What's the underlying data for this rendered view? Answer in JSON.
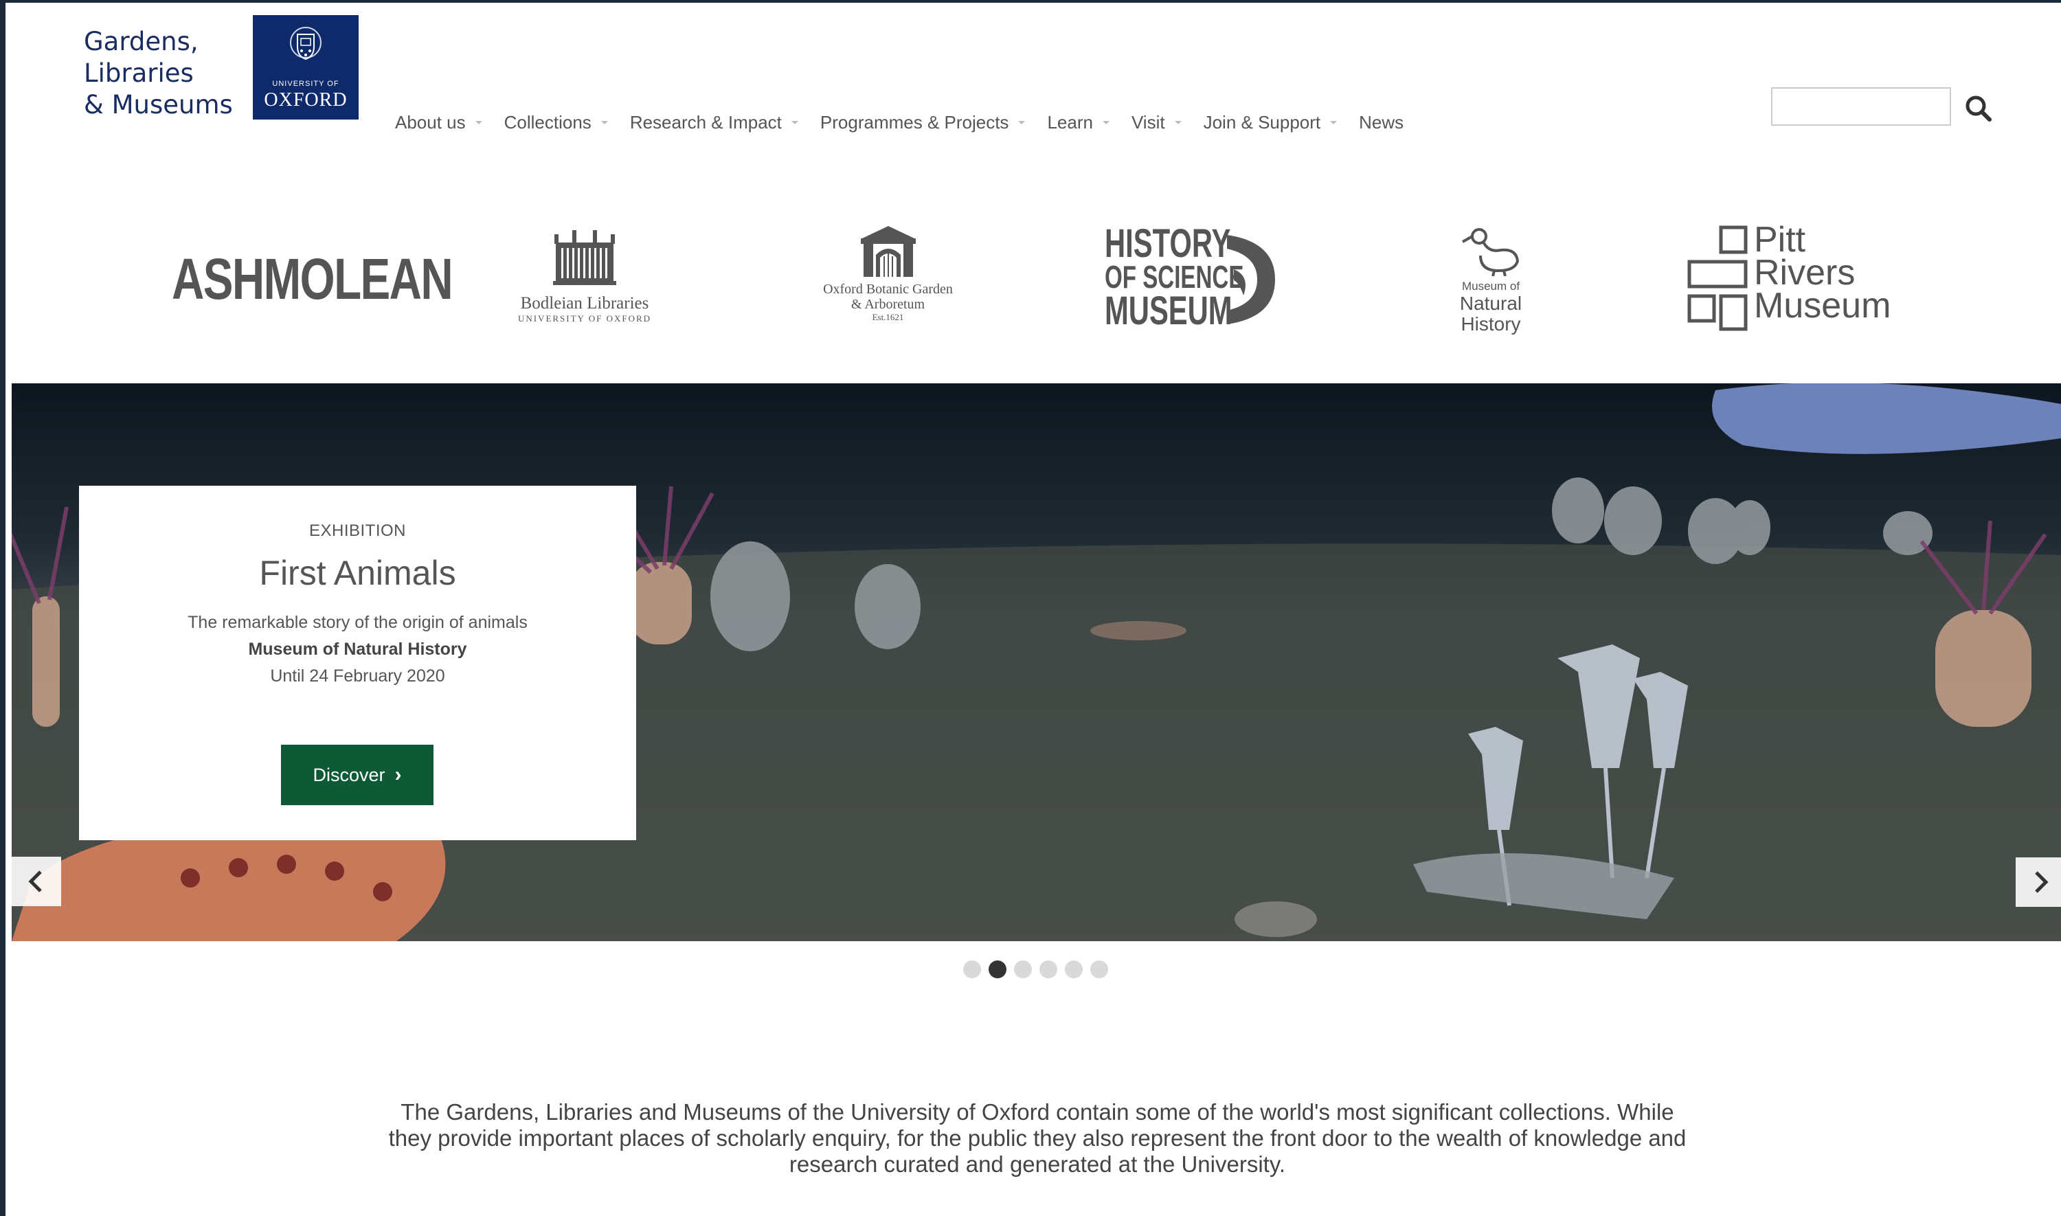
{
  "brand": {
    "name_lines": [
      "Gardens,",
      "Libraries",
      "& Museums"
    ],
    "oxford_small": "UNIVERSITY OF",
    "oxford_big": "OXFORD"
  },
  "nav": {
    "items": [
      {
        "label": "About us",
        "has_dropdown": true
      },
      {
        "label": "Collections",
        "has_dropdown": true
      },
      {
        "label": "Research & Impact",
        "has_dropdown": true
      },
      {
        "label": "Programmes & Projects",
        "has_dropdown": true
      },
      {
        "label": "Learn",
        "has_dropdown": true
      },
      {
        "label": "Visit",
        "has_dropdown": true
      },
      {
        "label": "Join & Support",
        "has_dropdown": true
      },
      {
        "label": "News",
        "has_dropdown": false
      }
    ]
  },
  "search": {
    "value": "",
    "placeholder": "",
    "icon": "search-icon"
  },
  "museums": {
    "ashmolean": "ASHMOLEAN",
    "bodleian": {
      "line1": "Bodleian Libraries",
      "line2": "UNIVERSITY OF OXFORD"
    },
    "botanic": {
      "line1": "Oxford Botanic Garden",
      "line2": "& Arboretum",
      "line3": "Est.1621"
    },
    "history_of_science": [
      "HISTORY",
      "OF SCIENCE",
      "MUSEUM"
    ],
    "natural_history": {
      "line1": "Museum of",
      "line2": "Natural",
      "line3": "History"
    },
    "pitt_rivers": [
      "Pitt",
      "Rivers",
      "Museum"
    ]
  },
  "hero": {
    "label": "EXHIBITION",
    "title": "First Animals",
    "description": "The remarkable story of the origin of animals",
    "venue": "Museum of Natural History",
    "date": "Until 24 February 2020",
    "button_label": "Discover",
    "slide_count": 6,
    "active_slide": 2
  },
  "intro_text": "The Gardens, Libraries and Museums of the University of Oxford contain some of the world's most significant collections. While they provide important places of scholarly enquiry, for the public they also represent the front door to the wealth of knowledge and research curated and generated at the University.",
  "colors": {
    "brand_blue": "#1a2d63",
    "oxford_blue": "#0e2a6b",
    "button_green": "#0f5a36"
  }
}
